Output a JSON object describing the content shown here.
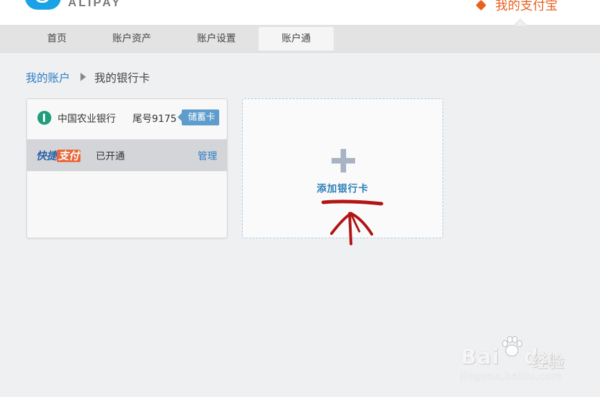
{
  "header": {
    "logo_text": "ALIPAY",
    "my_alipay": "我的支付宝",
    "accent_color": "#e8621f",
    "logo_color": "#1aa2e6"
  },
  "nav": {
    "items": [
      {
        "label": "首页"
      },
      {
        "label": "账户资产"
      },
      {
        "label": "账户设置"
      },
      {
        "label": "账户通"
      }
    ],
    "active": "账户通"
  },
  "breadcrumb": {
    "parent": "我的账户",
    "current": "我的银行卡"
  },
  "bank_card": {
    "bank_name": "中国农业银行",
    "tail_number": "尾号9175",
    "card_type": "储蓄卡",
    "quickpay_a": "快捷",
    "quickpay_b": "支付",
    "status": "已开通",
    "manage_label": "管理"
  },
  "add_card": {
    "label": "添加银行卡"
  },
  "watermark": {
    "brand": "Bai",
    "brand_suffix": "du",
    "cn": "经验",
    "url": "jingyan.baidu.com"
  }
}
